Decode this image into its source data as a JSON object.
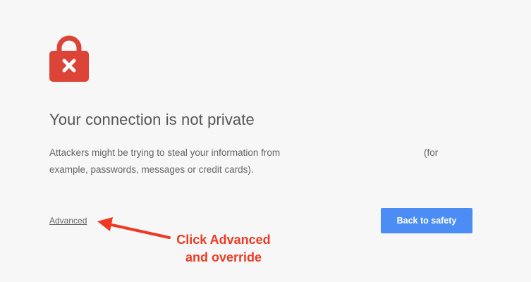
{
  "colors": {
    "background": "#f7f7f7",
    "lock_red": "#db4437",
    "button_blue": "#4b8cf5",
    "annotation_red": "#ee3a22"
  },
  "icon": "lock-error-icon",
  "title": "Your connection is not private",
  "description": {
    "line1_start": "Attackers might be trying to steal your information from",
    "line1_end": "(for",
    "line2": "example, passwords, messages or credit cards)."
  },
  "advanced_link": "Advanced",
  "back_button": "Back to safety",
  "annotation": {
    "line1": "Click Advanced",
    "line2": "and override"
  }
}
